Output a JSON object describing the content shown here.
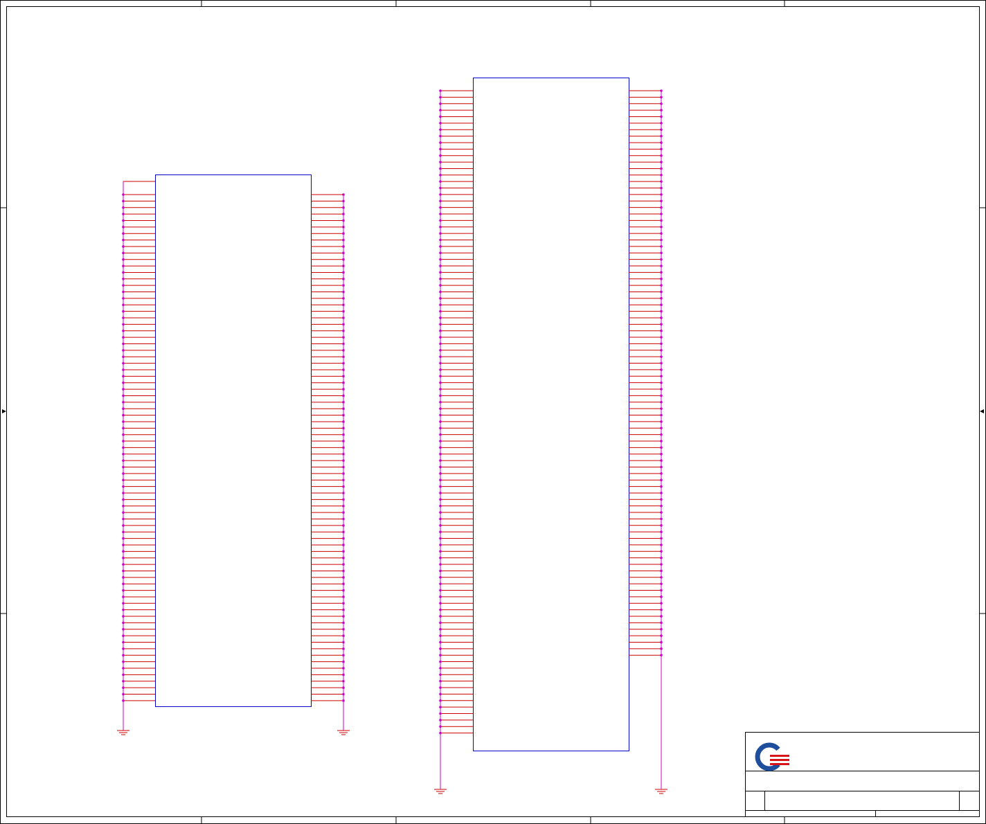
{
  "colors": {
    "frame": "#000000",
    "component_outline": "#0000cc",
    "pin_wire": "#cc0000",
    "net_dot": "#cc00cc",
    "ground": "#cc0000",
    "logo_blue": "#1f4e9c",
    "logo_red": "#d7141a"
  },
  "components": [
    {
      "id": "left-component",
      "left_pins": 79,
      "right_pins": 79,
      "top_stub": true
    },
    {
      "id": "right-component",
      "left_pins": 100,
      "right_pins": 88,
      "top_stub": false
    }
  ],
  "ground_symbols": 4,
  "title_block": {
    "logo": "company-logo",
    "title": "",
    "size": "",
    "document_number": "",
    "revision": "",
    "date": "",
    "sheet": ""
  }
}
